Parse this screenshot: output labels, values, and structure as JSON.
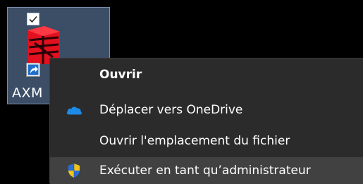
{
  "desktop_icon": {
    "label": "AXM",
    "selected": true,
    "checked": true,
    "icon": "axm-app-logo",
    "overlay_icon": "shortcut-arrow-icon"
  },
  "context_menu": {
    "items": [
      {
        "label": "Ouvrir",
        "icon": null,
        "default": true
      },
      {
        "label": "Déplacer vers OneDrive",
        "icon": "onedrive-cloud-icon"
      },
      {
        "label": "Ouvrir l'emplacement du fichier",
        "icon": null
      },
      {
        "label": "Exécuter en tant qu’administrateur",
        "icon": "uac-shield-icon",
        "highlighted": true
      }
    ]
  },
  "colors": {
    "desktop_background": "#000000",
    "menu_background": "#2b2b2b",
    "menu_highlight": "#414141",
    "selection_tint": "#6e8cb9",
    "onedrive_blue": "#1d8ae8",
    "logo_red": "#e3101f"
  }
}
